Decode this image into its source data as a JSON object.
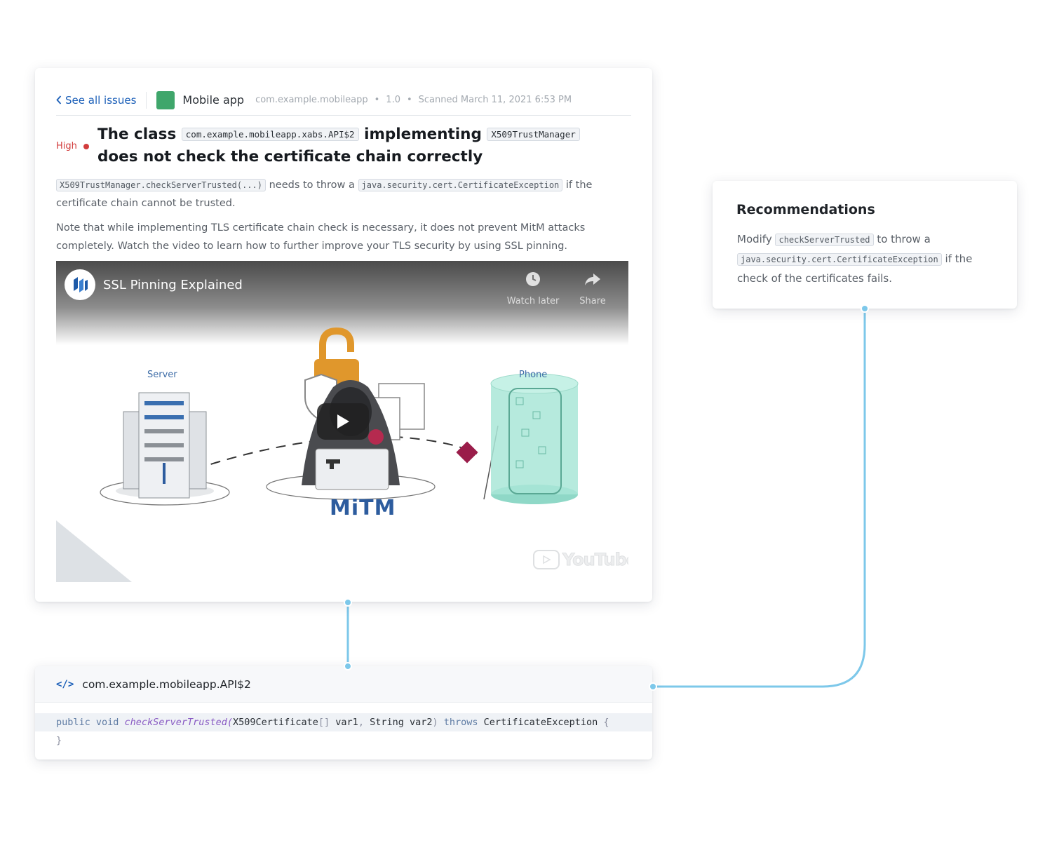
{
  "issue": {
    "back_label": "See all issues",
    "app_name": "Mobile app",
    "package": "com.example.mobileapp",
    "version": "1.0",
    "scanned": "Scanned March 11, 2021 6:53 PM",
    "separator": "•",
    "severity": "High",
    "title_part1": "The class",
    "title_code1": "com.example.mobileapp.xabs.API$2",
    "title_part2": "implementing",
    "title_code2": "X509TrustManager",
    "title_part3": "does not check the certificate chain correctly",
    "desc_code1": "X509TrustManager.checkServerTrusted(...)",
    "desc_text1": "needs to throw a",
    "desc_code2": "java.security.cert.CertificateException",
    "desc_text2": "if the certificate chain cannot be trusted.",
    "note": "Note that while implementing TLS certificate chain check is necessary, it does not prevent MitM attacks completely. Watch the video to learn how to further improve your TLS security by using SSL pinning."
  },
  "video": {
    "title": "SSL Pinning Explained",
    "watch_later": "Watch later",
    "share": "Share",
    "server_label": "Server",
    "phone_label": "Phone",
    "mitm_label": "MiTM",
    "youtube": "YouTube"
  },
  "recommendations": {
    "title": "Recommendations",
    "text1": "Modify",
    "code1": "checkServerTrusted",
    "text2": "to throw a",
    "code2": "java.security.cert.CertificateException",
    "text3": "if the check of the certificates fails."
  },
  "code": {
    "file": "com.example.mobileapp.API$2",
    "icon_glyph": "</>",
    "line1": {
      "kw1": "public void ",
      "fn": "checkServerTrusted(",
      "t1": "X509Certificate",
      "br1": "[] ",
      "t2": "var1",
      "br2": ", ",
      "t3": "String var2",
      "br3": ") ",
      "kw2": "throws ",
      "t4": "CertificateException ",
      "br4": "{"
    },
    "line2": "}"
  },
  "colors": {
    "accent": "#1b5fb8",
    "severity_high": "#d23c3c",
    "app_icon": "#3fa66b",
    "connector": "#7dc8ea"
  }
}
